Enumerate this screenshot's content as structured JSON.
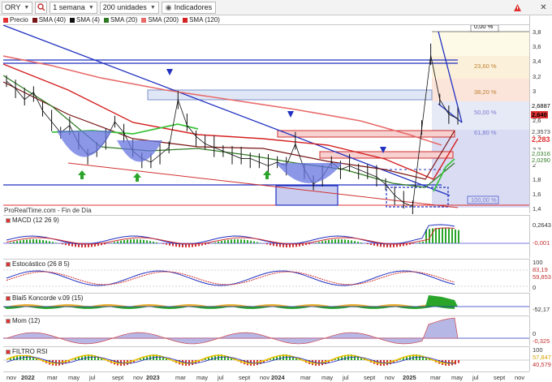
{
  "toolbar": {
    "symbol": "ORY",
    "timeframe": "1 semana",
    "units": "200 unidades",
    "indicators_label": "Indicadores"
  },
  "legend": [
    {
      "label": "Precio",
      "color": "#e03030"
    },
    {
      "label": "SMA (40)",
      "color": "#7a1414"
    },
    {
      "label": "SMA (4)",
      "color": "#111111"
    },
    {
      "label": "SMA (20)",
      "color": "#2f7a22"
    },
    {
      "label": "SMA (200)",
      "color": "#e86a6a"
    },
    {
      "label": "SMA (120)",
      "color": "#d42020"
    }
  ],
  "watermark": "ProRealTime.com - Fin de Día",
  "price_axis": {
    "ticks": [
      "3,8",
      "3,6",
      "3,4",
      "3,2",
      "3",
      "2,8",
      "2,6",
      "2,4",
      "2,2",
      "2",
      "1,8",
      "1,6",
      "1,4"
    ],
    "tags": [
      {
        "text": "2,6887",
        "color": "#ffffff",
        "text_color": "#000000"
      },
      {
        "text": "2,640",
        "color": "#e03030",
        "text_color": "#000000"
      },
      {
        "text": "2,3573",
        "color": "#ffffff",
        "text_color": "#444444"
      },
      {
        "text": "2,283",
        "color": "#ffffff",
        "text_color": "#e03030"
      },
      {
        "text": "2,0316",
        "color": "#ffffff",
        "text_color": "#2f7a22"
      },
      {
        "text": "2,0290",
        "color": "#ffffff",
        "text_color": "#2f7a22"
      }
    ]
  },
  "fib_labels": [
    "0,00 %",
    "23,60 %",
    "38,20 %",
    "50,00 %",
    "61,80 %",
    "100,00 %"
  ],
  "indicators": [
    {
      "title": "MACD (12 26 9)",
      "ticks": [
        "0,2643",
        "-0,001"
      ]
    },
    {
      "title": "Estocástico (26 8 5)",
      "ticks": [
        "100",
        "83,19",
        "59,853",
        "0"
      ]
    },
    {
      "title": "Blai5 Koncorde v.09 (15)",
      "ticks": [
        "-52,17"
      ]
    },
    {
      "title": "Mom (12)",
      "ticks": [
        "0",
        "-0,325"
      ]
    },
    {
      "title": "FILTRO RSI",
      "ticks": [
        "100",
        "57,847",
        "40,579"
      ]
    }
  ],
  "x_axis": [
    "nov",
    "2022",
    "mar",
    "may",
    "jul",
    "sept",
    "nov",
    "2023",
    "mar",
    "may",
    "jul",
    "sept",
    "nov",
    "2024",
    "mar",
    "may",
    "jul",
    "sept",
    "nov",
    "2025",
    "mar",
    "may",
    "jul",
    "sept",
    "nov"
  ],
  "chart_data": {
    "type": "line",
    "title": "",
    "series": [
      {
        "name": "Precio",
        "values": [
          3.15,
          3.05,
          2.9,
          3.0,
          2.75,
          2.6,
          2.45,
          2.55,
          2.3,
          2.15,
          2.2,
          2.35,
          2.6,
          2.45,
          2.2,
          2.1,
          2.05,
          2.15,
          2.25,
          2.9,
          2.55,
          2.4,
          2.3,
          2.25,
          2.2,
          2.15,
          2.1,
          2.1,
          2.05,
          2.0,
          2.05,
          2.0,
          2.3,
          1.95,
          1.75,
          1.85,
          2.05,
          1.95,
          2.0,
          1.95,
          1.9,
          1.85,
          1.75,
          1.6,
          1.5,
          1.45,
          2.5,
          3.5,
          2.9,
          2.7,
          2.64
        ]
      }
    ],
    "ylim": [
      1.35,
      3.85
    ]
  }
}
